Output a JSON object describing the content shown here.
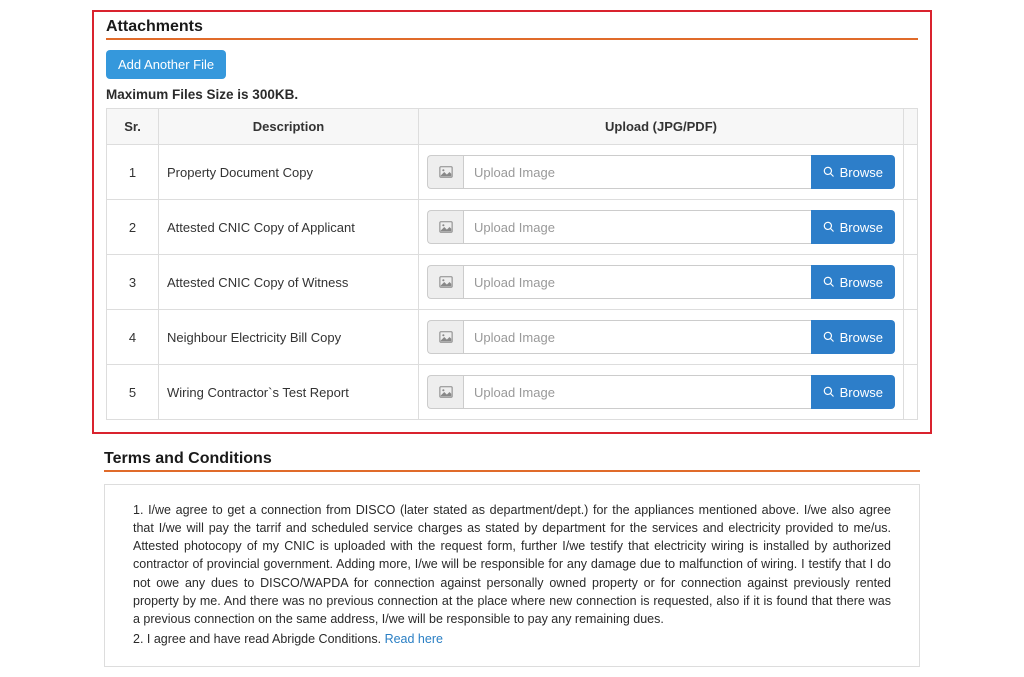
{
  "attachments": {
    "title": "Attachments",
    "add_button": "Add Another File",
    "max_note": "Maximum Files Size is 300KB.",
    "headers": {
      "sr": "Sr.",
      "desc": "Description",
      "upload": "Upload (JPG/PDF)"
    },
    "input_placeholder": "Upload Image",
    "browse_label": "Browse",
    "rows": [
      {
        "sr": "1",
        "desc": "Property Document Copy"
      },
      {
        "sr": "2",
        "desc": "Attested CNIC Copy of Applicant"
      },
      {
        "sr": "3",
        "desc": "Attested CNIC Copy of Witness"
      },
      {
        "sr": "4",
        "desc": "Neighbour Electricity Bill Copy"
      },
      {
        "sr": "5",
        "desc": "Wiring Contractor`s Test Report"
      }
    ]
  },
  "terms": {
    "title": "Terms and Conditions",
    "para1": "1. I/we agree to get a connection from DISCO (later stated as department/dept.) for the appliances mentioned above. I/we also agree that I/we will pay the tarrif and scheduled service charges as stated by department for the services and electricity provided to me/us. Attested photocopy of my CNIC is uploaded with the request form, further I/we testify that electricity wiring is installed by authorized contractor of provincial government. Adding more, I/we will be responsible for any damage due to malfunction of wiring. I testify that I do not owe any dues to DISCO/WAPDA for connection against personally owned property or for connection against previously rented property by me. And there was no previous connection at the place where new connection is requested, also if it is found that there was a previous connection on the same address, I/we will be responsible to pay any remaining dues.",
    "para2_prefix": "2. I agree and have read Abrigde Conditions. ",
    "read_here": "Read here"
  }
}
